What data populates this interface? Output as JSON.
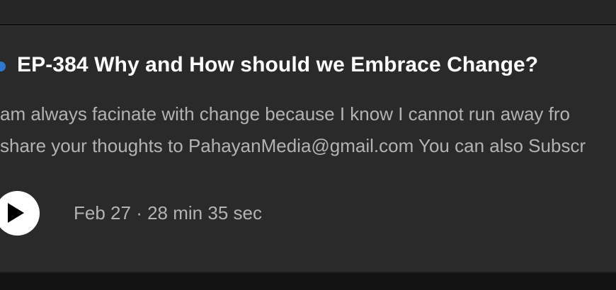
{
  "episode": {
    "title": "EP-384 Why and How should we Embrace Change?",
    "description_lines": [
      " am always facinate with change because I know I cannot run away fro",
      "share your thoughts to PahayanMedia@gmail.com You can also Subscr"
    ],
    "date": "Feb 27",
    "separator": "·",
    "duration": "28 min 35 sec",
    "new_indicator_color": "#2e77d0"
  },
  "icons": {
    "play": "play-icon"
  }
}
